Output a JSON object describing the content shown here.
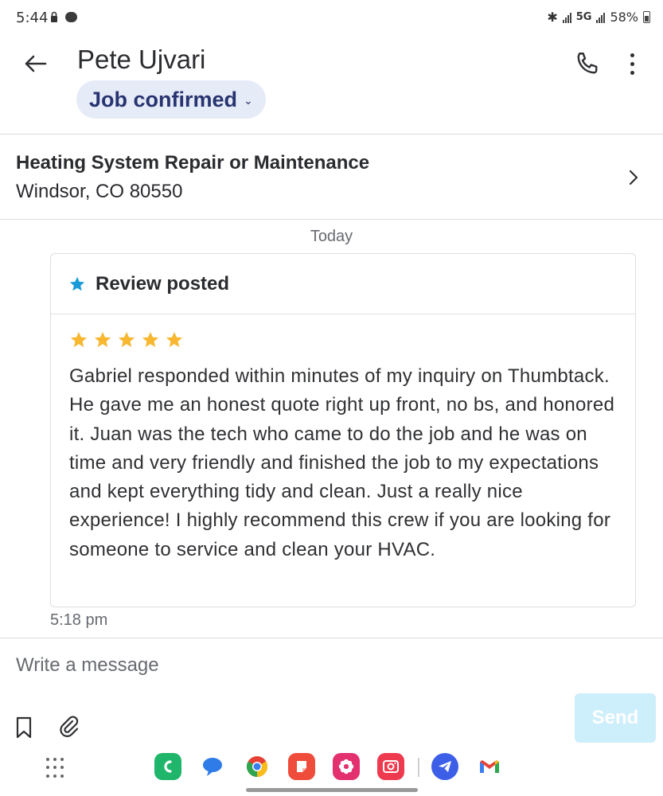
{
  "status_bar": {
    "time": "5:44",
    "network": "5G",
    "battery": "58%"
  },
  "header": {
    "contact_name": "Pete Ujvari",
    "job_status": "Job confirmed"
  },
  "job": {
    "title": "Heating System Repair or Maintenance",
    "location": "Windsor, CO 80550"
  },
  "conversation": {
    "date_label": "Today",
    "review_card": {
      "header": "Review posted",
      "rating": 5,
      "rating_max": 5,
      "text": "Gabriel responded within minutes of my inquiry on Thumbtack. He gave me an honest quote right up front, no bs, and honored it. Juan was the tech who came to do the job and he was on time and very friendly and finished the job to my expectations and kept everything tidy and clean. Just a really nice experience! I highly recommend this crew if you are looking for someone to service and clean your HVAC."
    },
    "message_time": "5:18 pm"
  },
  "composer": {
    "placeholder": "Write a message",
    "value": "",
    "send_label": "Send"
  },
  "dock": {
    "apps": [
      "phone-app-icon",
      "messages-app-icon",
      "chrome-app-icon",
      "notes-app-icon",
      "flower-app-icon",
      "camera-app-icon",
      "telegram-app-icon",
      "gmail-app-icon"
    ]
  },
  "colors": {
    "pill_background": "#e6ebf8",
    "pill_text": "#283470",
    "star_rating": "#f7b731",
    "review_star": "#1a9bd7",
    "send_button_disabled": "#cdeefb"
  }
}
